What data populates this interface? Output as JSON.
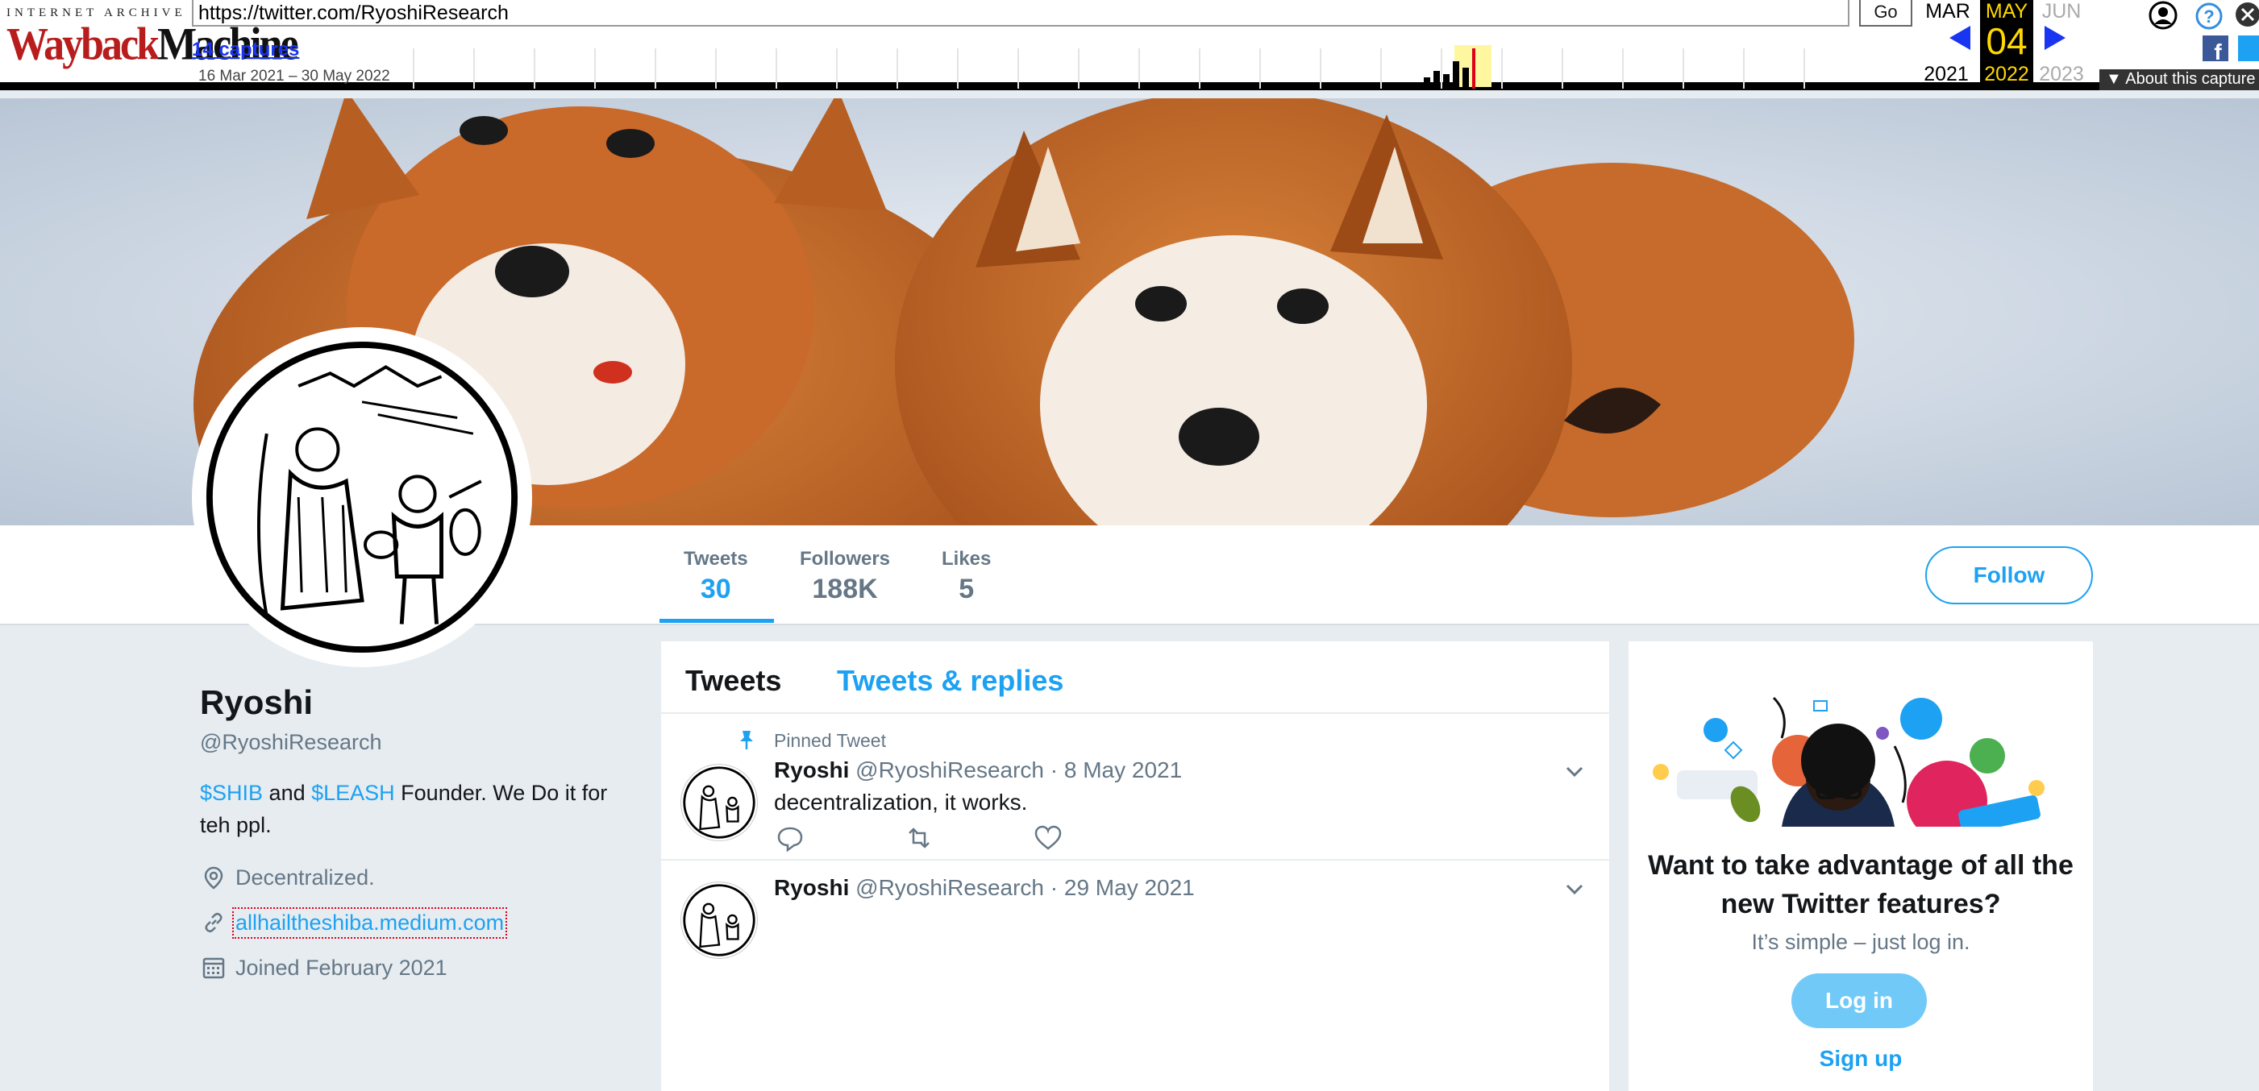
{
  "wayback": {
    "logo_top": "INTERNET ARCHIVE",
    "logo_main_a": "Wayback",
    "logo_main_b": "Machine",
    "url": "https://twitter.com/RyoshiResearch",
    "go_label": "Go",
    "captures": "14 captures",
    "range": "16 Mar 2021 – 30 May 2022",
    "months": {
      "prev": "MAR",
      "cur": "MAY",
      "next": "JUN"
    },
    "day": "04",
    "years": {
      "prev": "2021",
      "cur": "2022",
      "next": "2023"
    },
    "about": "▼ About this capture",
    "colors": {
      "highlight": "#ffd700",
      "link": "#1a35f2"
    }
  },
  "profile": {
    "name": "Ryoshi",
    "handle": "@RyoshiResearch",
    "bio_token1": "$SHIB",
    "bio_and": " and ",
    "bio_token2": "$LEASH",
    "bio_rest": " Founder. We Do it for teh ppl.",
    "location": "Decentralized.",
    "website": "allhailtheshiba.medium.com",
    "joined": "Joined February 2021"
  },
  "stats": {
    "tweets_label": "Tweets",
    "tweets_value": "30",
    "followers_label": "Followers",
    "followers_value": "188K",
    "likes_label": "Likes",
    "likes_value": "5"
  },
  "follow_label": "Follow",
  "timeline": {
    "tabs": [
      "Tweets",
      "Tweets & replies"
    ],
    "pinned_label": "Pinned Tweet",
    "tweets": [
      {
        "name": "Ryoshi",
        "meta": "@RyoshiResearch · 8 May 2021",
        "text": "decentralization, it works."
      },
      {
        "name": "Ryoshi",
        "meta": "@RyoshiResearch · 29 May 2021",
        "text": ""
      }
    ]
  },
  "login_card": {
    "title": "Want to take advantage of all the new Twitter features?",
    "subtitle": "It’s simple – just log in.",
    "login_label": "Log in",
    "signup_label": "Sign up"
  },
  "colors": {
    "twitter_blue": "#1da1f2",
    "muted": "#657786",
    "background": "#e6ecf0"
  }
}
